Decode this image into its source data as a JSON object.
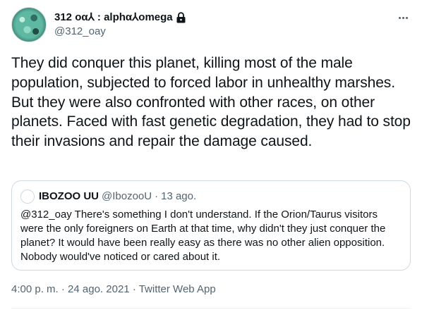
{
  "author": {
    "display_name": "312 οα⅄ : alphα⅄omega",
    "handle": "@312_oay",
    "lock_icon": "lock-icon"
  },
  "menu_icon": "more-icon",
  "tweet": {
    "text": "They did conquer this planet, killing most of the male population, subjected to forced labor in unhealthy marshes. But they were also confronted with other races, on other planets. Faced with fast genetic degradation, they had to stop their invasions and repair the damage caused."
  },
  "quoted_tweet": {
    "display_name": "IBOZOO UU",
    "handle": "@IbozooU",
    "separator": "·",
    "date": "13 ago.",
    "text": "@312_oay There's something I don't understand. If the Orion/Taurus visitors were the only foreigners on Earth at that time, why didn't they just conquer the planet? It would have been really easy as there was no other alien opposition. Nobody would've noticed or cared about it."
  },
  "meta": {
    "time": "4:00 p. m.",
    "separator": "·",
    "date": "24 ago. 2021",
    "source": "Twitter Web App"
  },
  "colors": {
    "text": "#0f1419",
    "secondary": "#536471",
    "border": "#cfd9de"
  }
}
